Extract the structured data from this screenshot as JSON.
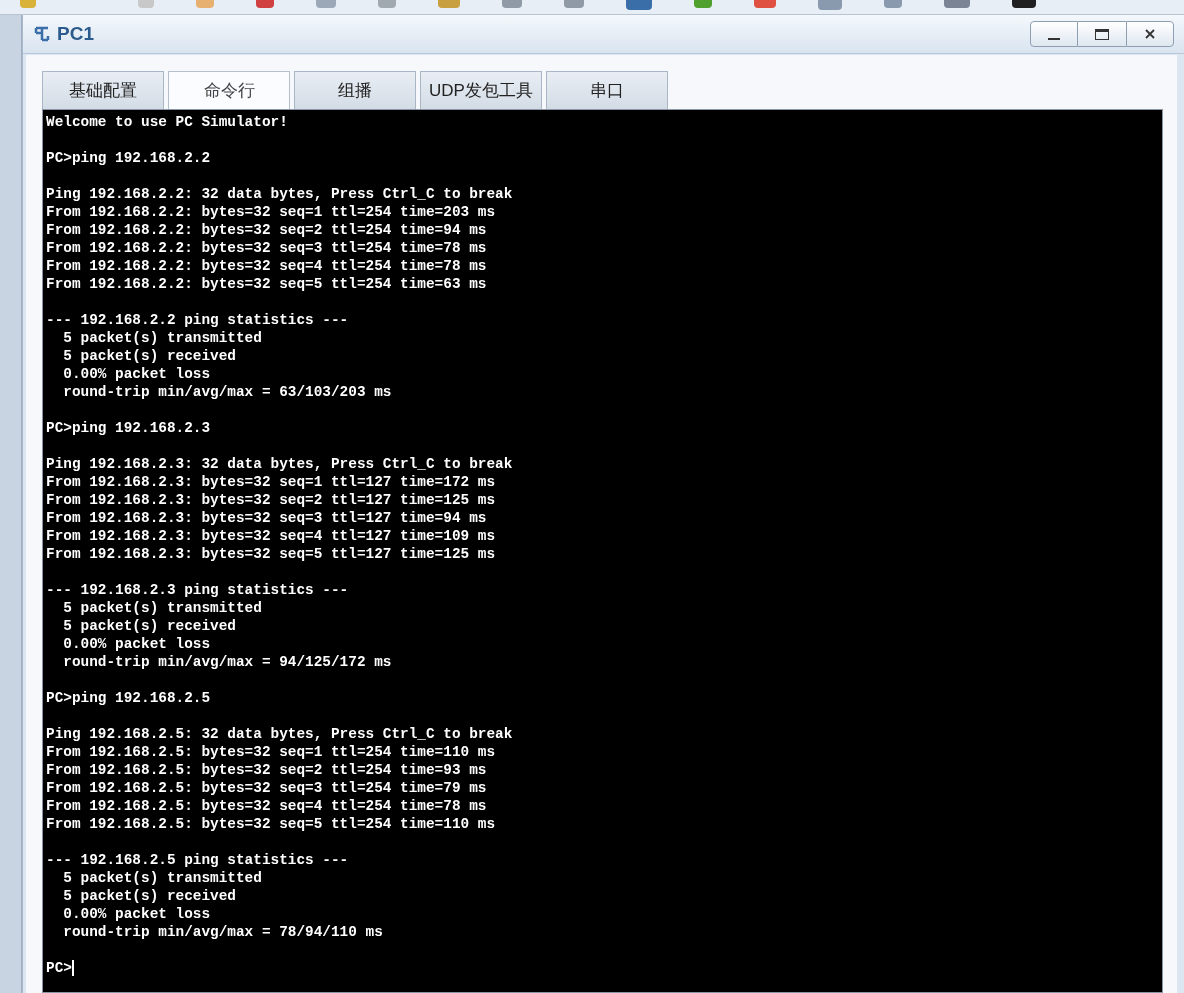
{
  "window": {
    "title": "PC1"
  },
  "tabs": [
    {
      "label": "基础配置",
      "selected": false
    },
    {
      "label": "命令行",
      "selected": true
    },
    {
      "label": "组播",
      "selected": false
    },
    {
      "label": "UDP发包工具",
      "selected": false
    },
    {
      "label": "串口",
      "selected": false
    }
  ],
  "terminal": {
    "blocks": [
      [
        "Welcome to use PC Simulator!"
      ],
      [
        "PC>ping 192.168.2.2"
      ],
      [
        "Ping 192.168.2.2: 32 data bytes, Press Ctrl_C to break",
        "From 192.168.2.2: bytes=32 seq=1 ttl=254 time=203 ms",
        "From 192.168.2.2: bytes=32 seq=2 ttl=254 time=94 ms",
        "From 192.168.2.2: bytes=32 seq=3 ttl=254 time=78 ms",
        "From 192.168.2.2: bytes=32 seq=4 ttl=254 time=78 ms",
        "From 192.168.2.2: bytes=32 seq=5 ttl=254 time=63 ms"
      ],
      [
        "--- 192.168.2.2 ping statistics ---",
        "  5 packet(s) transmitted",
        "  5 packet(s) received",
        "  0.00% packet loss",
        "  round-trip min/avg/max = 63/103/203 ms"
      ],
      [
        "PC>ping 192.168.2.3"
      ],
      [
        "Ping 192.168.2.3: 32 data bytes, Press Ctrl_C to break",
        "From 192.168.2.3: bytes=32 seq=1 ttl=127 time=172 ms",
        "From 192.168.2.3: bytes=32 seq=2 ttl=127 time=125 ms",
        "From 192.168.2.3: bytes=32 seq=3 ttl=127 time=94 ms",
        "From 192.168.2.3: bytes=32 seq=4 ttl=127 time=109 ms",
        "From 192.168.2.3: bytes=32 seq=5 ttl=127 time=125 ms"
      ],
      [
        "--- 192.168.2.3 ping statistics ---",
        "  5 packet(s) transmitted",
        "  5 packet(s) received",
        "  0.00% packet loss",
        "  round-trip min/avg/max = 94/125/172 ms"
      ],
      [
        "PC>ping 192.168.2.5"
      ],
      [
        "Ping 192.168.2.5: 32 data bytes, Press Ctrl_C to break",
        "From 192.168.2.5: bytes=32 seq=1 ttl=254 time=110 ms",
        "From 192.168.2.5: bytes=32 seq=2 ttl=254 time=93 ms",
        "From 192.168.2.5: bytes=32 seq=3 ttl=254 time=79 ms",
        "From 192.168.2.5: bytes=32 seq=4 ttl=254 time=78 ms",
        "From 192.168.2.5: bytes=32 seq=5 ttl=254 time=110 ms"
      ],
      [
        "--- 192.168.2.5 ping statistics ---",
        "  5 packet(s) transmitted",
        "  5 packet(s) received",
        "  0.00% packet loss",
        "  round-trip min/avg/max = 78/94/110 ms"
      ]
    ],
    "prompt": "PC>"
  }
}
